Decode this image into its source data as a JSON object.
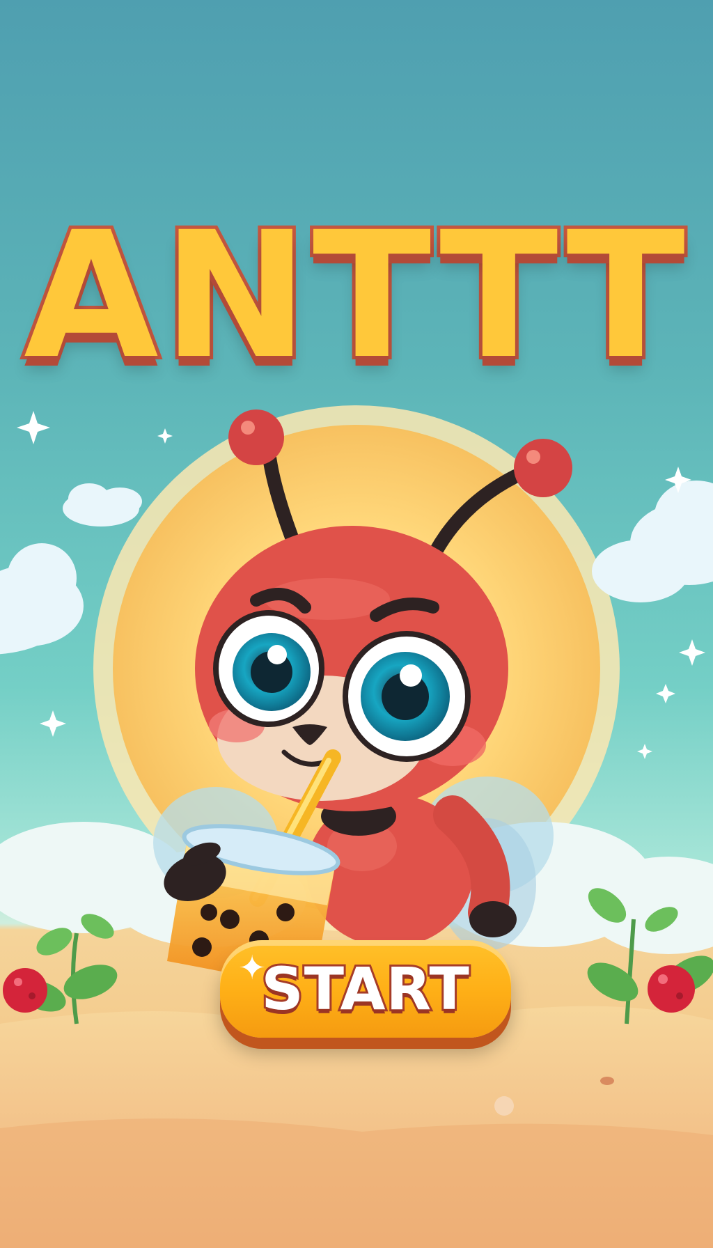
{
  "game": {
    "title": "ANTTT",
    "start_label": "START"
  },
  "colors": {
    "title_fill": "#ffc83a",
    "title_outline": "#c4563f",
    "button": "#ffb017",
    "ant_body": "#e0524a",
    "sky": "#5db5b8",
    "sand": "#f3c98a"
  },
  "icons": {
    "sparkle": "✦"
  }
}
